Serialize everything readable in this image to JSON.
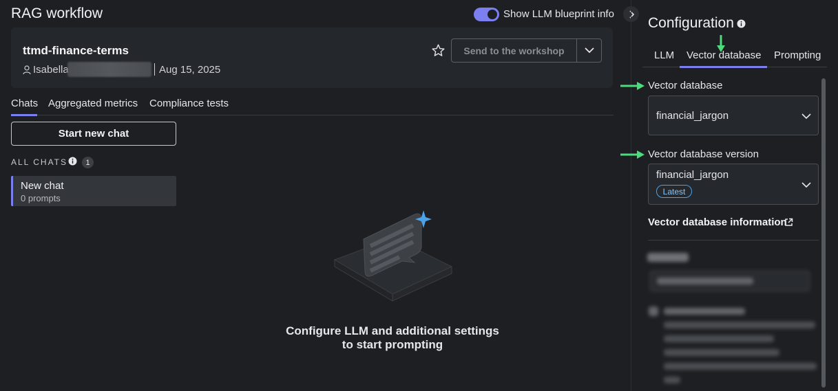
{
  "header": {
    "title": "RAG workflow",
    "toggle_label": "Show LLM blueprint info",
    "toggle_on": true
  },
  "blueprint": {
    "name": "ttmd-finance-terms",
    "owner": "Isabella",
    "date": "Aug 15, 2025",
    "send_label": "Send to the workshop"
  },
  "tabs": [
    {
      "label": "Chats",
      "active": true
    },
    {
      "label": "Aggregated metrics",
      "active": false
    },
    {
      "label": "Compliance tests",
      "active": false
    }
  ],
  "chats": {
    "new_chat_label": "Start new chat",
    "section_label": "ALL CHATS",
    "count": "1",
    "items": [
      {
        "title": "New chat",
        "subtitle": "0 prompts"
      }
    ]
  },
  "empty_state": {
    "line1": "Configure LLM and additional settings",
    "line2": "to start prompting"
  },
  "config": {
    "title": "Configuration",
    "tabs": [
      {
        "label": "LLM",
        "active": false
      },
      {
        "label": "Vector database",
        "active": true
      },
      {
        "label": "Prompting",
        "active": false
      }
    ],
    "vector_db_label": "Vector database",
    "vector_db_value": "financial_jargon",
    "vector_db_version_label": "Vector database version",
    "vector_db_version_value": "financial_jargon",
    "version_badge": "Latest",
    "info_link": "Vector database information"
  },
  "colors": {
    "accent": "#7b7ff0",
    "annotation_arrow": "#4ddc7c",
    "badge_blue": "#4da3e8"
  }
}
